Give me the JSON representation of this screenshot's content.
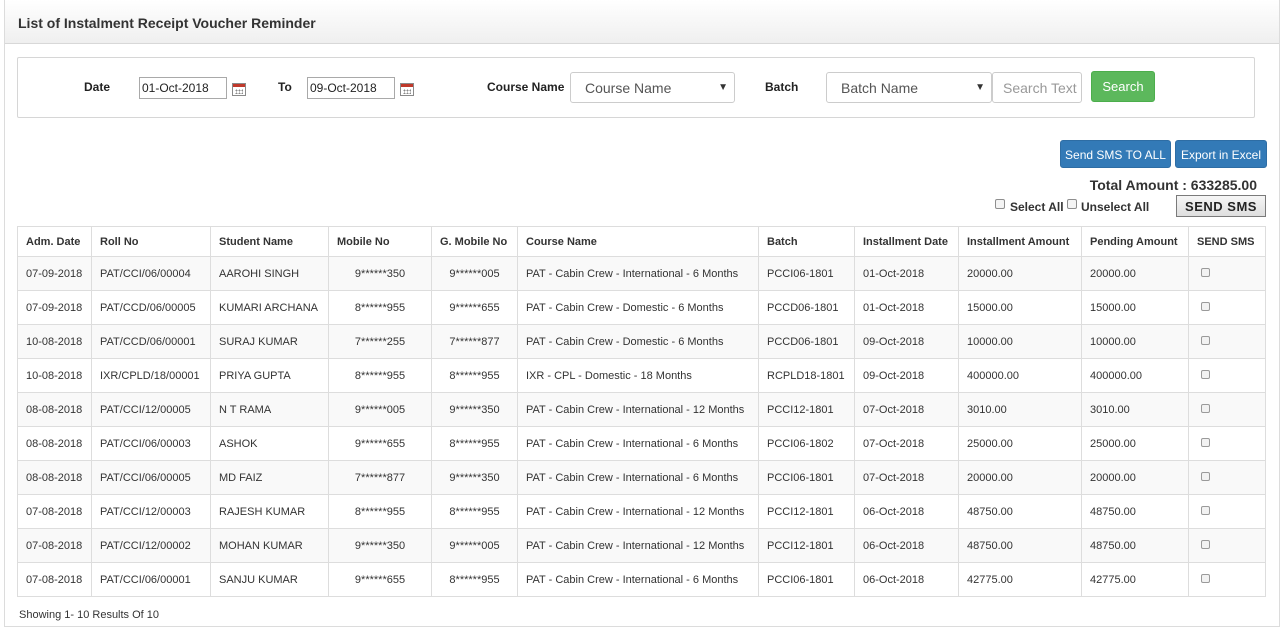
{
  "page": {
    "title": "List of Instalment Receipt Voucher Reminder"
  },
  "filters": {
    "date_label": "Date",
    "date_from": "01-Oct-2018",
    "to_label": "To",
    "date_to": "09-Oct-2018",
    "course_label": "Course Name",
    "course_selected": "Course Name",
    "batch_label": "Batch",
    "batch_selected": "Batch Name",
    "search_placeholder": "Search Text",
    "search_button": "Search"
  },
  "actions": {
    "send_sms_all": "Send SMS TO ALL",
    "export_excel": "Export in Excel",
    "total_amount": "Total Amount : 633285.00",
    "select_all": "Select All",
    "unselect_all": "Unselect All",
    "send_sms": "SEND SMS"
  },
  "table": {
    "headers": [
      "Adm. Date",
      "Roll No",
      "Student Name",
      "Mobile No",
      "G. Mobile No",
      "Course Name",
      "Batch",
      "Installment Date",
      "Installment Amount",
      "Pending Amount",
      "SEND SMS"
    ],
    "rows": [
      [
        "07-09-2018",
        "PAT/CCI/06/00004",
        "AAROHI SINGH",
        "9******350",
        "9******005",
        "PAT - Cabin Crew - International - 6 Months",
        "PCCI06-1801",
        "01-Oct-2018",
        "20000.00",
        "20000.00"
      ],
      [
        "07-09-2018",
        "PAT/CCD/06/00005",
        "KUMARI ARCHANA",
        "8******955",
        "9******655",
        "PAT - Cabin Crew - Domestic - 6 Months",
        "PCCD06-1801",
        "01-Oct-2018",
        "15000.00",
        "15000.00"
      ],
      [
        "10-08-2018",
        "PAT/CCD/06/00001",
        "SURAJ KUMAR",
        "7******255",
        "7******877",
        "PAT - Cabin Crew - Domestic - 6 Months",
        "PCCD06-1801",
        "09-Oct-2018",
        "10000.00",
        "10000.00"
      ],
      [
        "10-08-2018",
        "IXR/CPLD/18/00001",
        "PRIYA GUPTA",
        "8******955",
        "8******955",
        "IXR - CPL - Domestic - 18 Months",
        "RCPLD18-1801",
        "09-Oct-2018",
        "400000.00",
        "400000.00"
      ],
      [
        "08-08-2018",
        "PAT/CCI/12/00005",
        "N T RAMA",
        "9******005",
        "9******350",
        "PAT - Cabin Crew - International - 12 Months",
        "PCCI12-1801",
        "07-Oct-2018",
        "3010.00",
        "3010.00"
      ],
      [
        "08-08-2018",
        "PAT/CCI/06/00003",
        "ASHOK",
        "9******655",
        "8******955",
        "PAT - Cabin Crew - International - 6 Months",
        "PCCI06-1802",
        "07-Oct-2018",
        "25000.00",
        "25000.00"
      ],
      [
        "08-08-2018",
        "PAT/CCI/06/00005",
        "MD FAIZ",
        "7******877",
        "9******350",
        "PAT - Cabin Crew - International - 6 Months",
        "PCCI06-1801",
        "07-Oct-2018",
        "20000.00",
        "20000.00"
      ],
      [
        "07-08-2018",
        "PAT/CCI/12/00003",
        "RAJESH KUMAR",
        "8******955",
        "8******955",
        "PAT - Cabin Crew - International - 12 Months",
        "PCCI12-1801",
        "06-Oct-2018",
        "48750.00",
        "48750.00"
      ],
      [
        "07-08-2018",
        "PAT/CCI/12/00002",
        "MOHAN KUMAR",
        "9******350",
        "9******005",
        "PAT - Cabin Crew - International - 12 Months",
        "PCCI12-1801",
        "06-Oct-2018",
        "48750.00",
        "48750.00"
      ],
      [
        "07-08-2018",
        "PAT/CCI/06/00001",
        "SANJU KUMAR",
        "9******655",
        "8******955",
        "PAT - Cabin Crew - International - 6 Months",
        "PCCI06-1801",
        "06-Oct-2018",
        "42775.00",
        "42775.00"
      ]
    ]
  },
  "footer": {
    "showing": "Showing 1- 10 Results Of 10"
  },
  "colors": {
    "primary": "#337ab7",
    "success": "#5cb85c"
  },
  "icons": {
    "calendar": "calendar-icon",
    "dropdown": "chevron-down-icon"
  }
}
